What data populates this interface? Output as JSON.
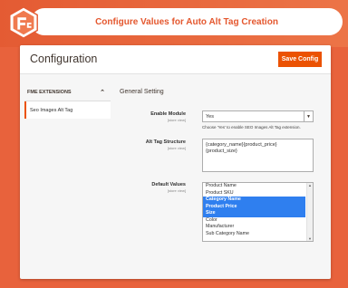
{
  "header": {
    "title": "Configure Values for Auto Alt Tag Creation"
  },
  "page": {
    "title": "Configuration",
    "save_label": "Save Config"
  },
  "sidebar": {
    "group_label": "FME EXTENSIONS",
    "items": [
      {
        "label": "Seo Images Alt Tag",
        "active": true
      }
    ]
  },
  "section": {
    "title": "General Setting"
  },
  "fields": {
    "enable_module": {
      "label": "Enable Module",
      "scope": "[store view]",
      "value": "Yes",
      "note": "Choose 'Yes' to enable SEO Images Alt Tag extension."
    },
    "alt_tag_structure": {
      "label": "Alt Tag Structure",
      "scope": "[store view]",
      "value_line1": "{category_name}{product_price}",
      "value_line2": "{product_size}"
    },
    "default_values": {
      "label": "Default Values",
      "scope": "[store view]",
      "options": [
        {
          "label": "Product Name",
          "selected": false
        },
        {
          "label": "Product SKU",
          "selected": false
        },
        {
          "label": "Category Name",
          "selected": true
        },
        {
          "label": "Product Price",
          "selected": true
        },
        {
          "label": "Size",
          "selected": true
        },
        {
          "label": "Color",
          "selected": false
        },
        {
          "label": "Manufacturer",
          "selected": false
        },
        {
          "label": "Sub Category Name",
          "selected": false
        }
      ]
    }
  },
  "colors": {
    "brand_orange": "#e8623c",
    "button_orange": "#eb5202",
    "selection_blue": "#2f7fef"
  }
}
